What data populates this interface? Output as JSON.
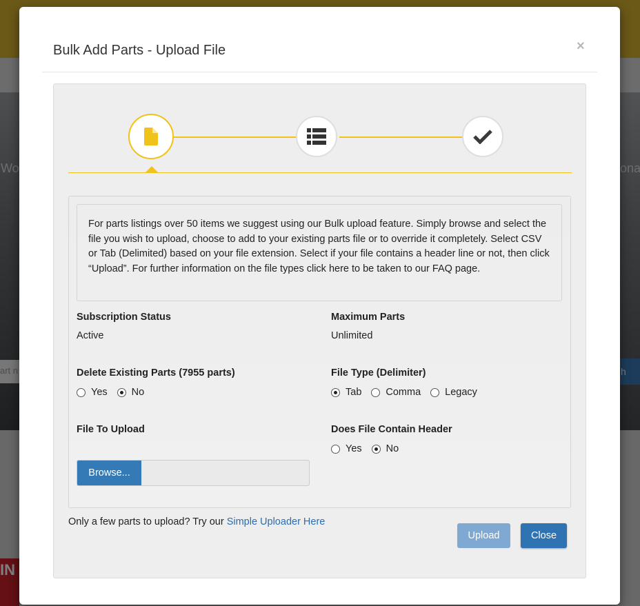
{
  "background": {
    "frag_left": "Wo",
    "frag_right": "ona",
    "frag_input": "art n",
    "frag_btn": "h",
    "frag_red": "IN"
  },
  "modal": {
    "title": "Bulk Add Parts - Upload File",
    "close_glyph": "×"
  },
  "steps": [
    {
      "icon": "file-icon",
      "active": true
    },
    {
      "icon": "list-icon",
      "active": false
    },
    {
      "icon": "check-icon",
      "active": false
    }
  ],
  "info_text": "For parts listings over 50 items we suggest using our Bulk upload feature. Simply browse and select the file you wish to upload, choose to add to your existing parts file or to override it completely. Select CSV or Tab (Delimited) based on your file extension. Select if your file contains a header line or not, then click “Upload”. For further information on the file types click here to be taken to our FAQ page.",
  "subscription": {
    "label": "Subscription Status",
    "value": "Active"
  },
  "max_parts": {
    "label": "Maximum Parts",
    "value": "Unlimited"
  },
  "delete_existing": {
    "label": "Delete Existing Parts (7955 parts)",
    "options": [
      {
        "label": "Yes",
        "checked": false
      },
      {
        "label": "No",
        "checked": true
      }
    ]
  },
  "file_type": {
    "label": "File Type (Delimiter)",
    "options": [
      {
        "label": "Tab",
        "checked": true
      },
      {
        "label": "Comma",
        "checked": false
      },
      {
        "label": "Legacy",
        "checked": false
      }
    ]
  },
  "file_upload": {
    "label": "File To Upload",
    "browse_label": "Browse..."
  },
  "has_header": {
    "label": "Does File Contain Header",
    "options": [
      {
        "label": "Yes",
        "checked": false
      },
      {
        "label": "No",
        "checked": true
      }
    ]
  },
  "footer": {
    "text": "Only a few parts to upload? Try our ",
    "link": "Simple Uploader Here",
    "upload_label": "Upload",
    "close_label": "Close"
  },
  "colors": {
    "accent": "#f0c21a",
    "primary": "#337ab7",
    "primary_disabled": "#7fa9d2"
  }
}
